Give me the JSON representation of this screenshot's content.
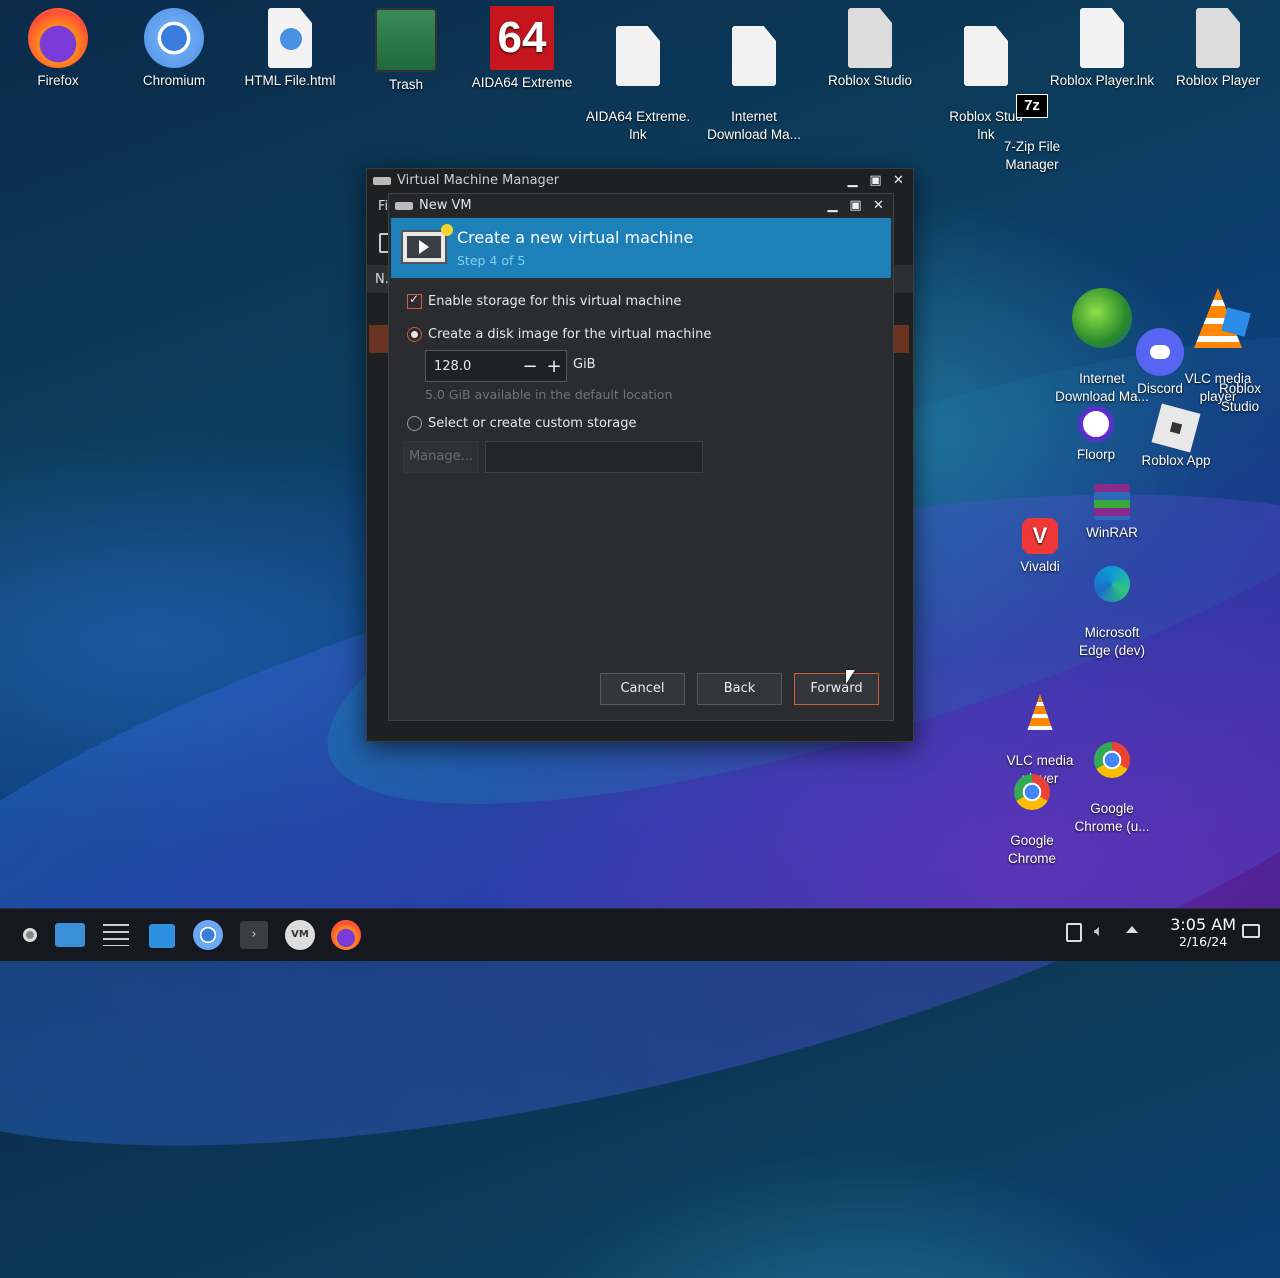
{
  "desktop": {
    "icons": [
      {
        "label": "Firefox",
        "icon": "firefox-icon"
      },
      {
        "label": "Chromium",
        "icon": "chromium-icon"
      },
      {
        "label": "HTML File.html",
        "icon": "html-file-icon"
      },
      {
        "label": "Trash",
        "icon": "trash-icon"
      },
      {
        "label": "AIDA64 Extreme",
        "icon": "aida64-icon",
        "badge": "64"
      },
      {
        "label": "AIDA64 Extreme.\nlnk",
        "icon": "file-icon"
      },
      {
        "label": "Internet\nDownload Ma...",
        "icon": "file-icon"
      },
      {
        "label": "Roblox Studio",
        "icon": "file-icon"
      },
      {
        "label": "Roblox Stud\nlnk",
        "icon": "file-icon"
      },
      {
        "label": "Roblox Player.lnk",
        "icon": "file-icon"
      },
      {
        "label": "Roblox Player",
        "icon": "file-icon"
      },
      {
        "label": "7-Zip File\nManager",
        "icon": "7zip-icon",
        "badge": "7z"
      },
      {
        "label": "Internet\nDownload Ma...",
        "icon": "idm-icon"
      },
      {
        "label": "VLC media\nplayer",
        "icon": "vlc-icon"
      },
      {
        "label": "Roblox\nStudio",
        "icon": "roblox-studio-icon"
      },
      {
        "label": "Discord",
        "icon": "discord-icon"
      },
      {
        "label": "Floorp",
        "icon": "floorp-icon"
      },
      {
        "label": "Roblox App",
        "icon": "roblox-app-icon"
      },
      {
        "label": "WinRAR",
        "icon": "winrar-icon"
      },
      {
        "label": "Vivaldi",
        "icon": "vivaldi-icon"
      },
      {
        "label": "Microsoft\nEdge (dev)",
        "icon": "edge-dev-icon"
      },
      {
        "label": "VLC media\nplayer",
        "icon": "vlc-icon"
      },
      {
        "label": "Google\nChrome",
        "icon": "chrome-icon"
      },
      {
        "label": "Google\nChrome (u...",
        "icon": "chrome-unstable-icon"
      }
    ]
  },
  "vmm": {
    "title": "Virtual Machine Manager",
    "menu_fragment": "Fi",
    "col_fragment": "N."
  },
  "newvm": {
    "title": "New VM",
    "banner_title": "Create a new virtual machine",
    "banner_step": "Step 4 of 5",
    "enable_storage": "Enable storage for this virtual machine",
    "create_disk": "Create a disk image for the virtual machine",
    "disk_size": "128.0",
    "disk_unit": "GiB",
    "available": "5.0 GiB available in the default location",
    "custom_storage": "Select or create custom storage",
    "manage": "Manage...",
    "custom_path": "",
    "cancel": "Cancel",
    "back": "Back",
    "forward": "Forward"
  },
  "taskbar": {
    "time": "3:05 AM",
    "date": "2/16/24"
  },
  "colors": {
    "accent": "#d45a3c",
    "banner": "#1e80b8"
  }
}
